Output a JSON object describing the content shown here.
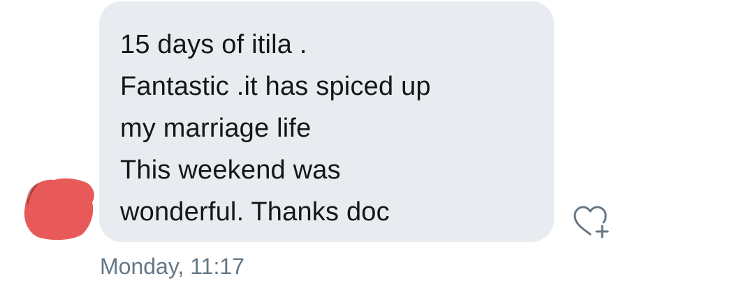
{
  "message": {
    "lines": [
      "15 days of itila .",
      "Fantastic .it has spiced up",
      "my marriage life",
      "This weekend was",
      "wonderful. Thanks doc"
    ],
    "timestamp": "Monday, 11:17"
  },
  "avatar": {
    "state": "redacted",
    "redaction_color": "#e85a5a"
  },
  "actions": {
    "like_icon": "heart-plus-icon"
  },
  "colors": {
    "bubble_bg": "#e8ecf0",
    "text": "#14171a",
    "timestamp": "#657786",
    "icon": "#657786"
  }
}
